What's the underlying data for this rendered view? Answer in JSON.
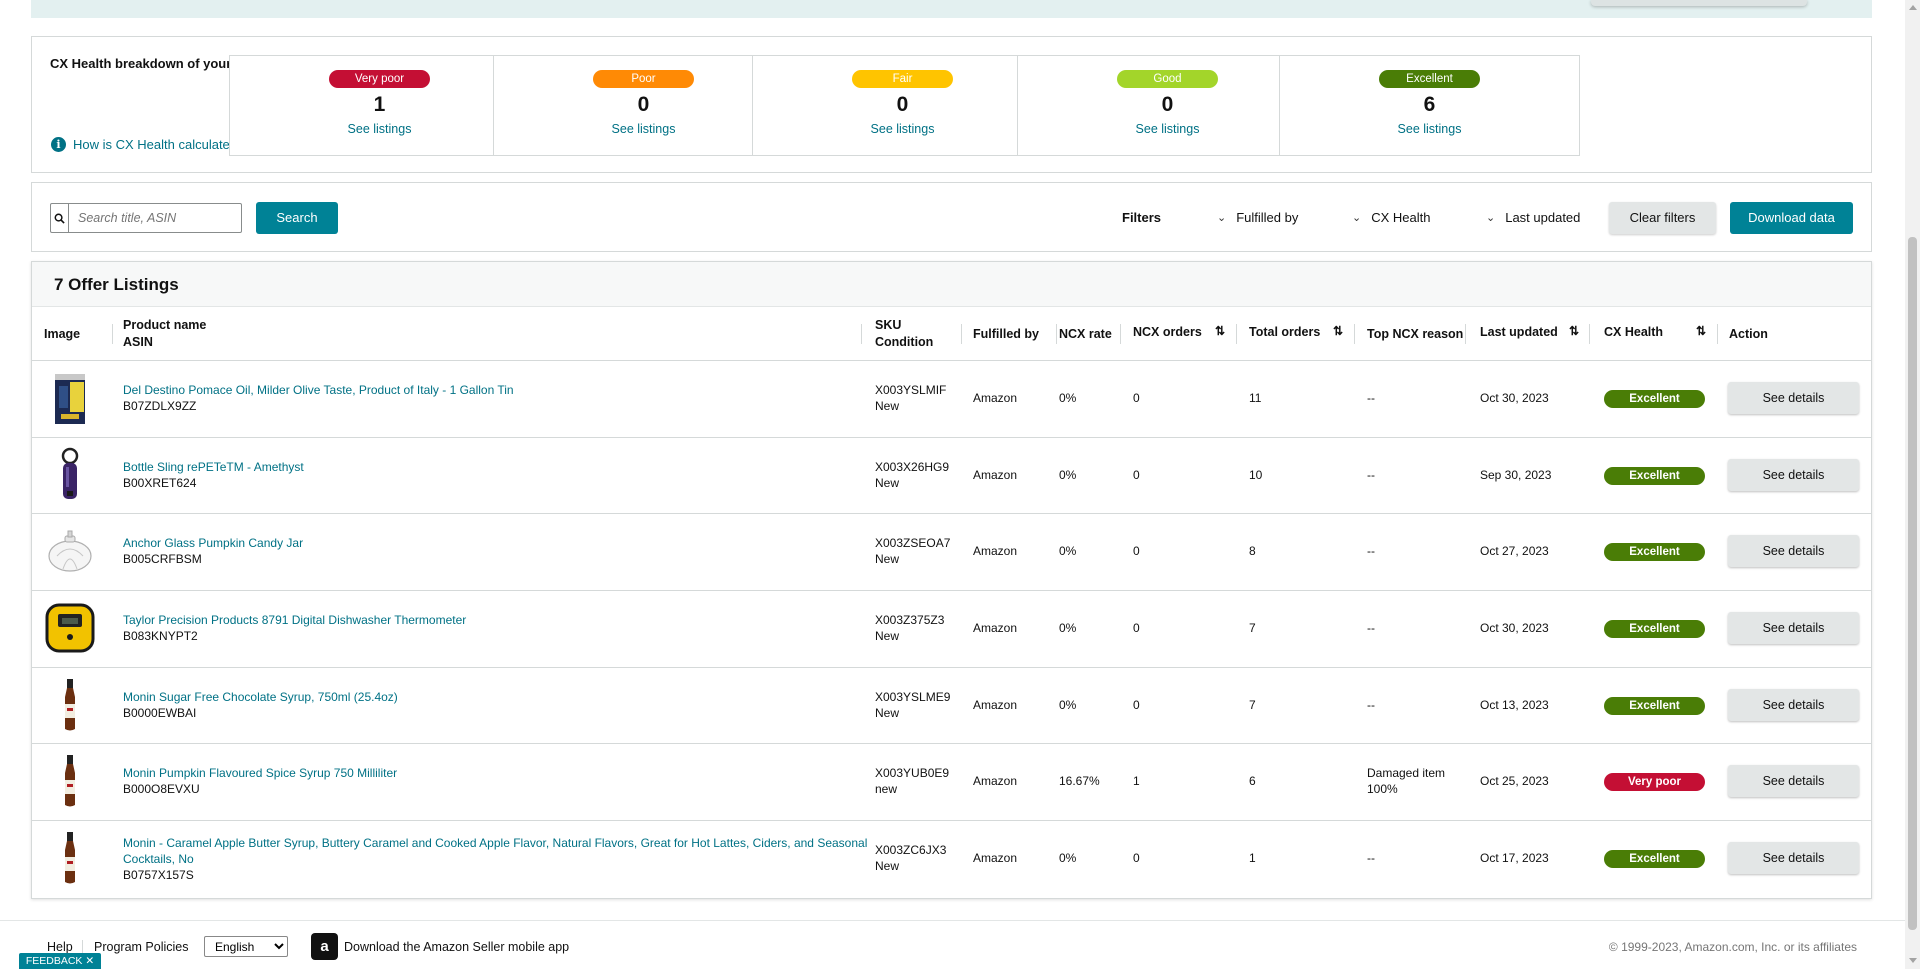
{
  "cx_breakdown": {
    "title": "CX Health breakdown of your listings",
    "help_link": "How is CX Health calculated?",
    "cards": [
      {
        "label": "Very poor",
        "count": "1",
        "link": "See listings",
        "color": "#c40f34"
      },
      {
        "label": "Poor",
        "count": "0",
        "link": "See listings",
        "color": "#ff8a05"
      },
      {
        "label": "Fair",
        "count": "0",
        "link": "See listings",
        "color": "#ffc400"
      },
      {
        "label": "Good",
        "count": "0",
        "link": "See listings",
        "color": "#a3d52a"
      },
      {
        "label": "Excellent",
        "count": "6",
        "link": "See listings",
        "color": "#4a7d06"
      }
    ]
  },
  "toolbar": {
    "search_placeholder": "Search title, ASIN",
    "search_button": "Search",
    "filters_label": "Filters",
    "filter_fulfilled_by": "Fulfilled by",
    "filter_cx_health": "CX Health",
    "filter_last_updated": "Last updated",
    "clear_filters": "Clear filters",
    "download_data": "Download data"
  },
  "listings": {
    "title": "7 Offer Listings",
    "columns": {
      "image": "Image",
      "product_name": "Product name",
      "asin": "ASIN",
      "sku": "SKU",
      "condition": "Condition",
      "fulfilled_by": "Fulfilled by",
      "ncx_rate": "NCX rate",
      "ncx_orders": "NCX orders",
      "total_orders": "Total orders",
      "top_ncx_reason": "Top NCX reason",
      "last_updated": "Last updated",
      "cx_health": "CX Health",
      "action": "Action"
    },
    "rows": [
      {
        "image_icon": "olive-oil-tin",
        "name": "Del Destino Pomace Oil, Milder Olive Taste, Product of Italy - 1 Gallon Tin",
        "asin": "B07ZDLX9ZZ",
        "sku": "X003YSLMIF",
        "condition": "New",
        "fulfilled_by": "Amazon",
        "ncx_rate": "0%",
        "ncx_orders": "0",
        "total_orders": "11",
        "top_ncx_reason": "--",
        "top_ncx_reason_2": "",
        "last_updated": "Oct 30, 2023",
        "cx_health": "Excellent",
        "cx_color": "#4a7d06",
        "action": "See details"
      },
      {
        "image_icon": "bottle-sling",
        "name": "Bottle Sling rePETeTM - Amethyst",
        "asin": "B00XRET624",
        "sku": "X003X26HG9",
        "condition": "New",
        "fulfilled_by": "Amazon",
        "ncx_rate": "0%",
        "ncx_orders": "0",
        "total_orders": "10",
        "top_ncx_reason": "--",
        "top_ncx_reason_2": "",
        "last_updated": "Sep 30, 2023",
        "cx_health": "Excellent",
        "cx_color": "#4a7d06",
        "action": "See details"
      },
      {
        "image_icon": "pumpkin-jar",
        "name": "Anchor Glass Pumpkin Candy Jar",
        "asin": "B005CRFBSM",
        "sku": "X003ZSEOA7",
        "condition": "New",
        "fulfilled_by": "Amazon",
        "ncx_rate": "0%",
        "ncx_orders": "0",
        "total_orders": "8",
        "top_ncx_reason": "--",
        "top_ncx_reason_2": "",
        "last_updated": "Oct 27, 2023",
        "cx_health": "Excellent",
        "cx_color": "#4a7d06",
        "action": "See details"
      },
      {
        "image_icon": "thermometer",
        "name": "Taylor Precision Products 8791 Digital Dishwasher Thermometer",
        "asin": "B083KNYPT2",
        "sku": "X003Z375Z3",
        "condition": "New",
        "fulfilled_by": "Amazon",
        "ncx_rate": "0%",
        "ncx_orders": "0",
        "total_orders": "7",
        "top_ncx_reason": "--",
        "top_ncx_reason_2": "",
        "last_updated": "Oct 30, 2023",
        "cx_health": "Excellent",
        "cx_color": "#4a7d06",
        "action": "See details"
      },
      {
        "image_icon": "syrup-bottle",
        "name": "Monin Sugar Free Chocolate Syrup, 750ml (25.4oz)",
        "asin": "B0000EWBAI",
        "sku": "X003YSLME9",
        "condition": "New",
        "fulfilled_by": "Amazon",
        "ncx_rate": "0%",
        "ncx_orders": "0",
        "total_orders": "7",
        "top_ncx_reason": "--",
        "top_ncx_reason_2": "",
        "last_updated": "Oct 13, 2023",
        "cx_health": "Excellent",
        "cx_color": "#4a7d06",
        "action": "See details"
      },
      {
        "image_icon": "syrup-bottle",
        "name": "Monin Pumpkin Flavoured Spice Syrup 750 Milliliter",
        "asin": "B000O8EVXU",
        "sku": "X003YUB0E9",
        "condition": "new",
        "fulfilled_by": "Amazon",
        "ncx_rate": "16.67%",
        "ncx_orders": "1",
        "total_orders": "6",
        "top_ncx_reason": "Damaged item",
        "top_ncx_reason_2": "100%",
        "last_updated": "Oct 25, 2023",
        "cx_health": "Very poor",
        "cx_color": "#c40f34",
        "action": "See details"
      },
      {
        "image_icon": "syrup-bottle",
        "name": "Monin - Caramel Apple Butter Syrup, Buttery Caramel and Cooked Apple Flavor, Natural Flavors, Great for Hot Lattes, Ciders, and Seasonal Cocktails, No",
        "asin": "B0757X157S",
        "sku": "X003ZC6JX3",
        "condition": "New",
        "fulfilled_by": "Amazon",
        "ncx_rate": "0%",
        "ncx_orders": "0",
        "total_orders": "1",
        "top_ncx_reason": "--",
        "top_ncx_reason_2": "",
        "last_updated": "Oct 17, 2023",
        "cx_health": "Excellent",
        "cx_color": "#4a7d06",
        "action": "See details"
      }
    ]
  },
  "footer": {
    "help": "Help",
    "program_policies": "Program Policies",
    "language": "English",
    "app_text": "Download the Amazon Seller mobile app",
    "copyright": "© 1999-2023, Amazon.com, Inc. or its affiliates",
    "feedback": "FEEDBACK"
  }
}
